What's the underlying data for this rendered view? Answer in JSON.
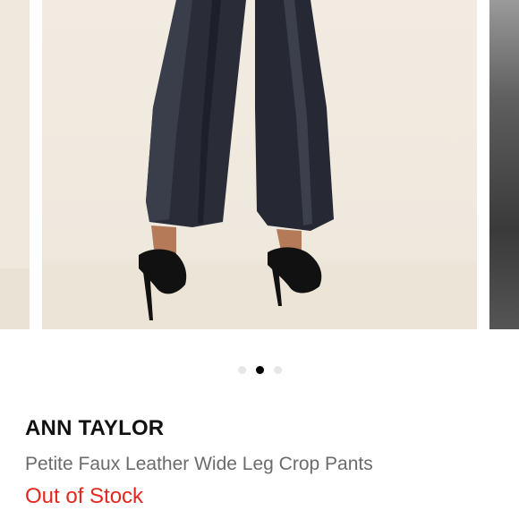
{
  "carousel": {
    "current_index": 1,
    "total_slides": 3,
    "image_description": "product-photo-black-faux-leather-wide-leg-crop-pants"
  },
  "product": {
    "brand": "ANN TAYLOR",
    "title": "Petite Faux Leather Wide Leg Crop Pants",
    "availability": "Out of Stock"
  },
  "colors": {
    "availability": "#e4261c",
    "active_dot": "#000000",
    "inactive_dot": "#e6e6e6"
  }
}
